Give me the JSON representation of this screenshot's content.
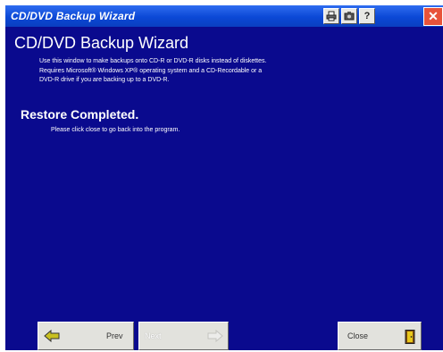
{
  "window": {
    "title": "CD/DVD Backup Wizard"
  },
  "header": {
    "heading": "CD/DVD Backup Wizard",
    "description": [
      "Use this window to make backups onto CD-R or DVD-R disks instead of diskettes.",
      "Requires Microsoft® Windows XP® operating system and a CD-Recordable or a",
      "DVD-R drive if you are backing up to a DVD-R."
    ]
  },
  "status": {
    "title": "Restore Completed.",
    "message": "Please click close to go back into the program."
  },
  "buttons": {
    "prev": "Prev",
    "next": "Next",
    "close": "Close"
  },
  "icons": {
    "title_buttons": [
      "print-icon",
      "camera-icon",
      "help-icon"
    ],
    "close": "close-icon",
    "prev": "arrow-left-icon",
    "next": "arrow-right-icon",
    "exit": "exit-door-icon"
  },
  "colors": {
    "background": "#0a0a8e",
    "titlebar": "#0b48d6",
    "close_button": "#e8533a"
  }
}
